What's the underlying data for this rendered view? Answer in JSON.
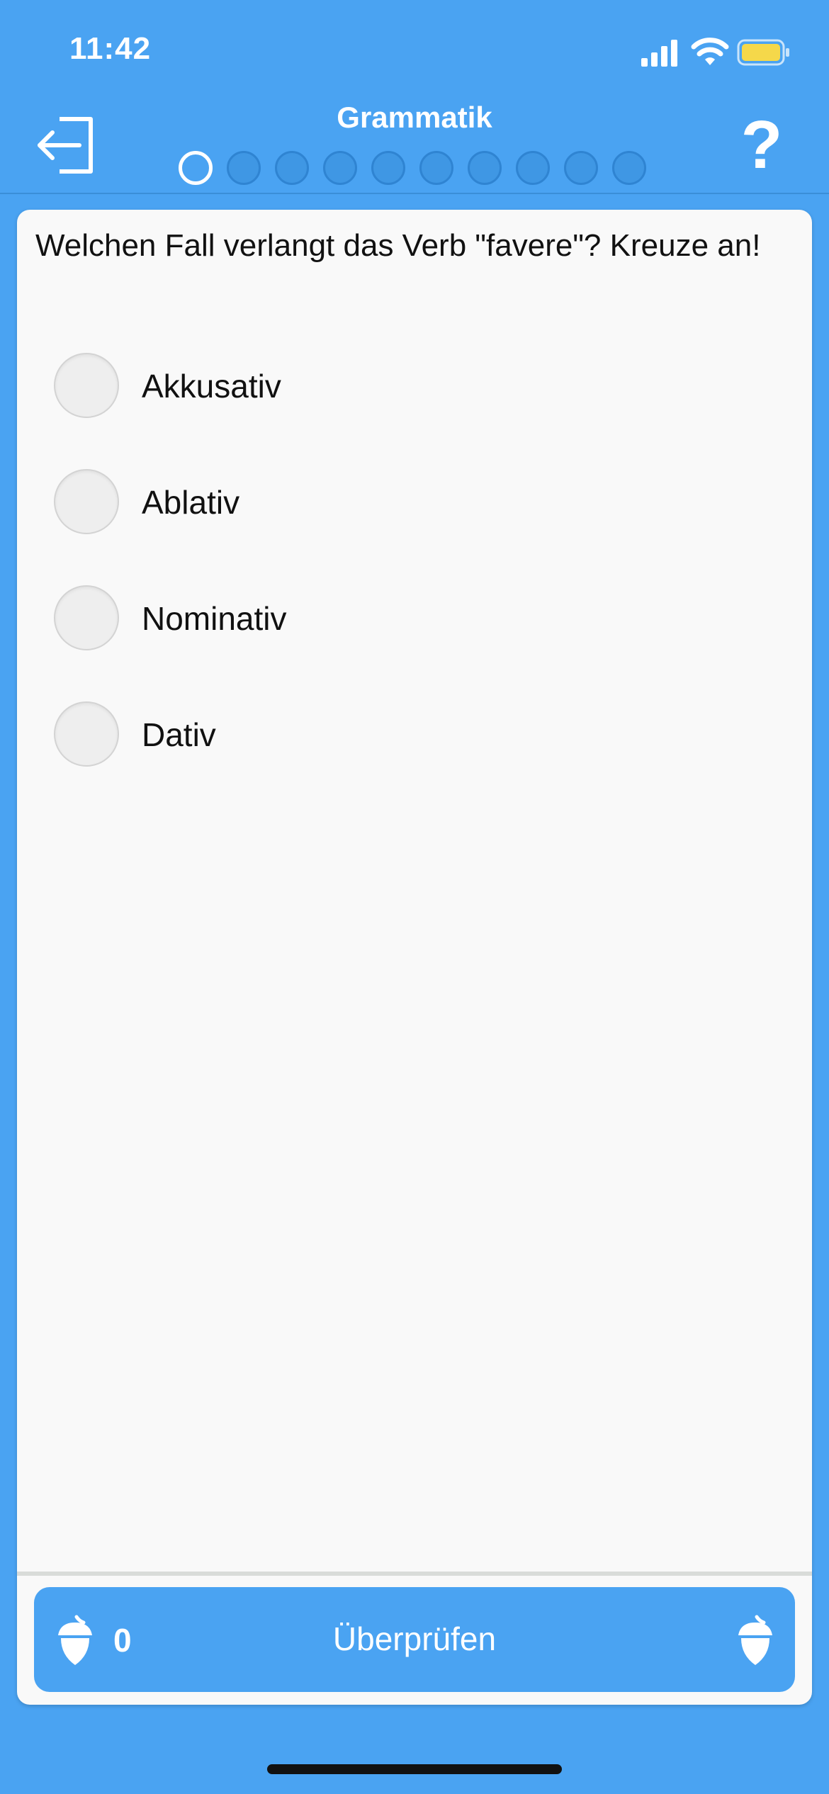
{
  "status_bar": {
    "time": "11:42",
    "signal_icon": "cellular-signal-icon",
    "wifi_icon": "wifi-icon",
    "battery_icon": "battery-icon",
    "battery_color": "#f5d84a"
  },
  "nav": {
    "title": "Grammatik",
    "exit_icon": "exit-icon",
    "help_label": "?",
    "progress": {
      "total": 10,
      "current_index": 0
    }
  },
  "question": {
    "text": "Welchen Fall verlangt das Verb \"favere\"? Kreuze an!",
    "options": [
      {
        "label": "Akkusativ"
      },
      {
        "label": "Ablativ"
      },
      {
        "label": "Nominativ"
      },
      {
        "label": "Dativ"
      }
    ]
  },
  "footer": {
    "acorn_count": "0",
    "check_label": "Überprüfen",
    "acorn_icon": "acorn-icon"
  },
  "colors": {
    "brand_blue": "#4aa3f2",
    "card_background": "#f9f9f9"
  }
}
